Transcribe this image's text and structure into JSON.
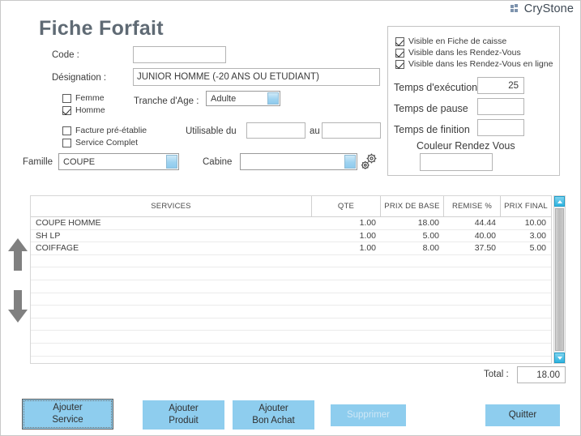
{
  "brand": {
    "name": "CryStone",
    "logo_icon": "crystone-logo-icon"
  },
  "header": {
    "title": "Fiche Forfait"
  },
  "form": {
    "code": {
      "label": "Code :",
      "value": "",
      "placeholder": ""
    },
    "designation": {
      "label": "Désignation :",
      "value": "JUNIOR HOMME (-20 ANS OU ÉTUDIANT)",
      "placeholder": ""
    },
    "femme": {
      "label": "Femme",
      "checked": false
    },
    "homme": {
      "label": "Homme",
      "checked": true
    },
    "tranche_age": {
      "label": "Tranche d'Age :",
      "value": "Adulte"
    },
    "facture_pre_etablie": {
      "label": "Facture pré-établie",
      "checked": false
    },
    "service_complet": {
      "label": "Service Complet",
      "checked": false
    },
    "utilisable_du": {
      "label": "Utilisable du",
      "value": "",
      "placeholder": ""
    },
    "au": {
      "label": "au",
      "value": "",
      "placeholder": ""
    },
    "famille": {
      "label": "Famille",
      "value": "COUPE"
    },
    "cabine": {
      "label": "Cabine",
      "value": ""
    },
    "cabine_settings_icon": "gears-icon"
  },
  "panel": {
    "visible_fiche_caisse": {
      "label": "Visible en Fiche de caisse",
      "checked": true
    },
    "visible_rdv": {
      "label": "Visible dans les Rendez-Vous",
      "checked": true
    },
    "visible_rdv_en_ligne": {
      "label": "Visible dans les Rendez-Vous en ligne",
      "checked": true
    },
    "temps_execution": {
      "label": "Temps d'exécution",
      "value": "25"
    },
    "temps_pause": {
      "label": "Temps de pause",
      "value": ""
    },
    "temps_finition": {
      "label": "Temps de finition",
      "value": ""
    },
    "couleur_rdv": {
      "label": "Couleur Rendez Vous",
      "value": ""
    }
  },
  "grid": {
    "columns": [
      "SERVICES",
      "QTE",
      "PRIX DE BASE",
      "REMISE %",
      "PRIX FINAL"
    ],
    "rows": [
      {
        "service": "COUPE HOMME",
        "qte": "1.00",
        "prix_base": "18.00",
        "remise": "44.44",
        "prix_final": "10.00"
      },
      {
        "service": "SH LP",
        "qte": "1.00",
        "prix_base": "5.00",
        "remise": "40.00",
        "prix_final": "3.00"
      },
      {
        "service": "COIFFAGE",
        "qte": "1.00",
        "prix_base": "8.00",
        "remise": "37.50",
        "prix_final": "5.00"
      }
    ],
    "empty_row_count": 8,
    "move_up_icon": "arrow-up-icon",
    "move_down_icon": "arrow-down-icon",
    "scroll_up_icon": "scroll-up-icon",
    "scroll_down_icon": "scroll-down-icon"
  },
  "total": {
    "label": "Total :",
    "value": "18.00"
  },
  "buttons": {
    "ajouter_service": {
      "line1": "Ajouter",
      "line2": "Service",
      "focused": true,
      "disabled": false
    },
    "ajouter_produit": {
      "line1": "Ajouter",
      "line2": "Produit",
      "focused": false,
      "disabled": false
    },
    "ajouter_bon_achat": {
      "line1": "Ajouter",
      "line2": "Bon Achat",
      "focused": false,
      "disabled": false
    },
    "supprimer": {
      "line1": "Supprimer",
      "line2": "",
      "focused": false,
      "disabled": true
    },
    "quitter": {
      "line1": "Quitter",
      "line2": "",
      "focused": false,
      "disabled": false
    }
  },
  "colors": {
    "accent_button": "#8ecdee",
    "scroll_button": "#2fb4e0",
    "title_text": "#5f6a74",
    "combo_arrow": "#9fd3f0"
  }
}
